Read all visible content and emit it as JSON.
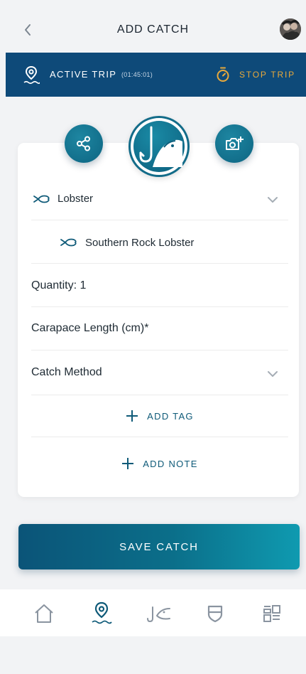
{
  "header": {
    "title": "ADD CATCH",
    "back_icon": "chevron-left-icon",
    "avatar_icon": "user-avatar"
  },
  "trip_bar": {
    "label": "ACTIVE TRIP",
    "elapsed": "(01:45:01)",
    "stop_label": "STOP TRIP",
    "background": "#0e4a79",
    "stop_color": "#e8a93b"
  },
  "actions_top": {
    "share_icon": "share-icon",
    "catch_icon": "fish-hook-icon",
    "camera_icon": "add-photo-icon"
  },
  "form": {
    "category": {
      "value": "Lobster",
      "icon": "lobster-icon"
    },
    "species": {
      "value": "Southern Rock Lobster",
      "icon": "lobster-icon"
    },
    "quantity": {
      "label": "Quantity: 1"
    },
    "carapace": {
      "label": "Carapace Length (cm)*"
    },
    "method": {
      "label": "Catch Method"
    },
    "add_tag": "ADD TAG",
    "add_note": "ADD NOTE"
  },
  "save": {
    "label": "SAVE CATCH"
  },
  "tabbar": {
    "items": [
      {
        "name": "home",
        "icon": "home-icon",
        "active": false
      },
      {
        "name": "trip",
        "icon": "location-pin-icon",
        "active": true
      },
      {
        "name": "catch",
        "icon": "fish-icon",
        "active": false
      },
      {
        "name": "rules",
        "icon": "shield-icon",
        "active": false
      },
      {
        "name": "more",
        "icon": "dashboard-icon",
        "active": false
      }
    ]
  },
  "colors": {
    "accent": "#0e5a78",
    "teal": "#136c89",
    "background": "#f2f3f5"
  }
}
